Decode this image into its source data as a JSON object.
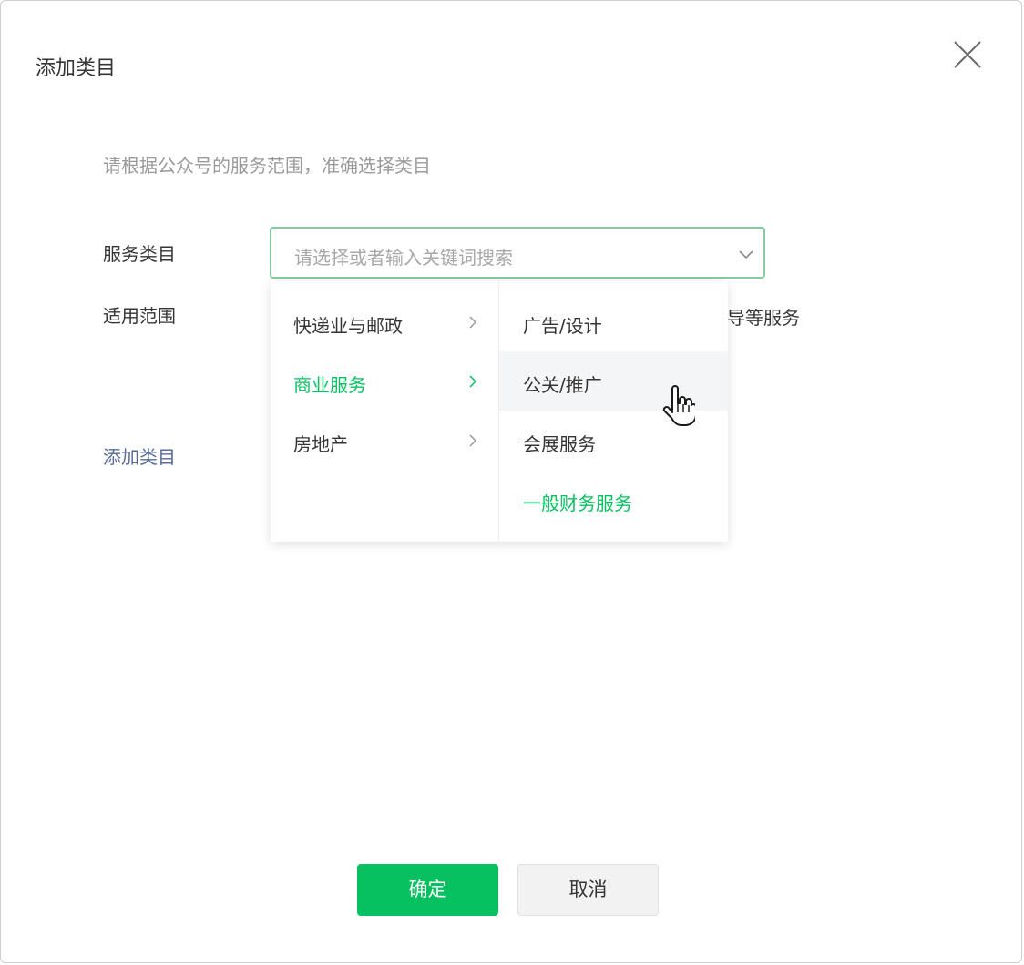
{
  "dialog": {
    "title": "添加类目",
    "close_icon": "close-icon",
    "hint": "请根据公众号的服务范围，准确选择类目"
  },
  "form": {
    "service_label": "服务类目",
    "scope_label": "适用范围",
    "scope_value_partial": "导等服务",
    "select_placeholder": "请选择或者输入关键词搜索",
    "add_category_link": "添加类目"
  },
  "cascader": {
    "level1": [
      {
        "label": "快递业与邮政",
        "active": false
      },
      {
        "label": "商业服务",
        "active": true
      },
      {
        "label": "房地产",
        "active": false
      }
    ],
    "level2": [
      {
        "label": "广告/设计",
        "state": "normal"
      },
      {
        "label": "公关/推广",
        "state": "hover"
      },
      {
        "label": "会展服务",
        "state": "normal"
      },
      {
        "label": "一般财务服务",
        "state": "selected"
      }
    ]
  },
  "footer": {
    "confirm_label": "确定",
    "cancel_label": "取消"
  },
  "colors": {
    "accent": "#07c160",
    "link": "#576b95",
    "focus_border": "#7fcf9e",
    "hover_bg": "#f4f5f6"
  }
}
